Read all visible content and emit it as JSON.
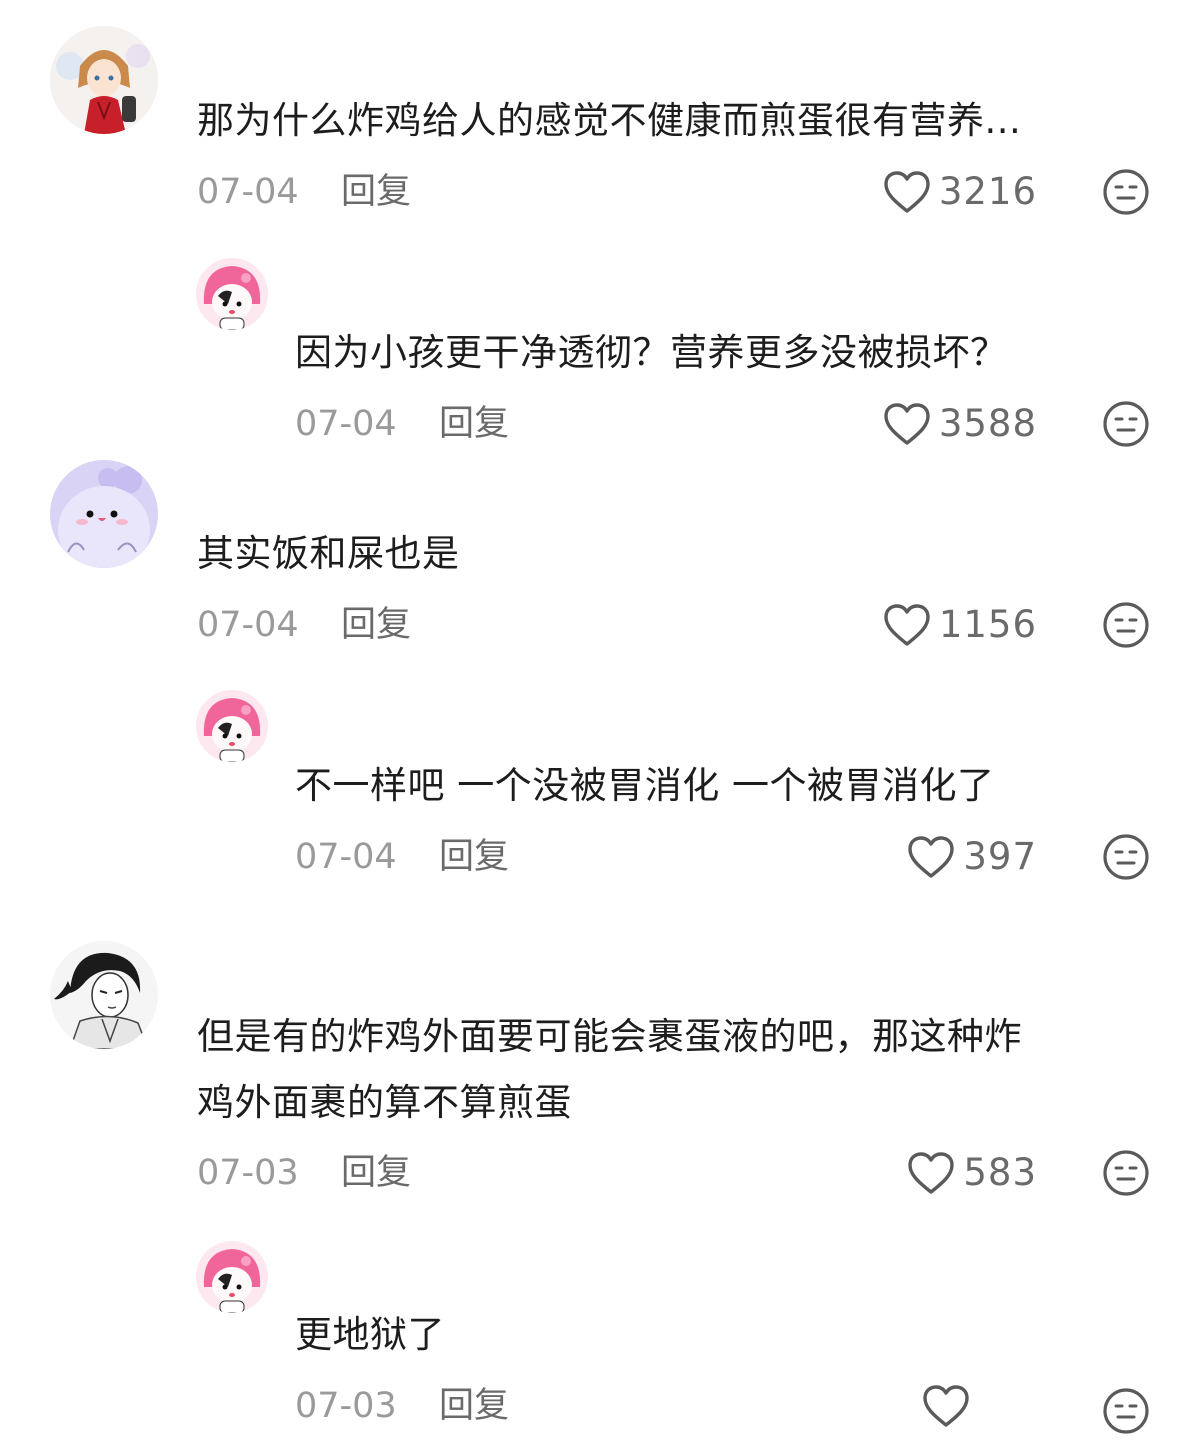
{
  "comments": [
    {
      "text": [
        "那为什么炸鸡给人的感觉不健康而煎蛋很有营养..."
      ],
      "date": "07-04",
      "reply_label": "回复",
      "likes": "3216",
      "avatar": "anime-girl-red-dress-avatar"
    },
    {
      "text": [
        "因为小孩更干净透彻？营养更多没被损坏？"
      ],
      "date": "07-04",
      "reply_label": "回复",
      "likes": "3588",
      "avatar": "pink-hood-cartoon-avatar"
    },
    {
      "text": [
        "其实饭和屎也是"
      ],
      "date": "07-04",
      "reply_label": "回复",
      "likes": "1156",
      "avatar": "purple-blob-avatar"
    },
    {
      "text": [
        "不一样吧 一个没被胃消化 一个被胃消化了"
      ],
      "date": "07-04",
      "reply_label": "回复",
      "likes": "397",
      "avatar": "pink-hood-cartoon-avatar"
    },
    {
      "text": [
        "但是有的炸鸡外面要可能会裹蛋液的吧，那这种炸",
        "鸡外面裹的算不算煎蛋"
      ],
      "date": "07-03",
      "reply_label": "回复",
      "likes": "583",
      "avatar": "sketch-man-avatar"
    },
    {
      "text": [
        "更地狱了"
      ],
      "date": "07-03",
      "reply_label": "回复",
      "likes": "",
      "avatar": "pink-hood-cartoon-avatar"
    }
  ],
  "icons": {
    "like": "heart-outline-icon",
    "reaction": "neutral-face-icon"
  },
  "colors": {
    "text": "#1d1d1d",
    "muted": "#9a9a9a",
    "action": "#6a6a6a",
    "pink": "#f0659a",
    "lavender": "#d9d3f6"
  }
}
